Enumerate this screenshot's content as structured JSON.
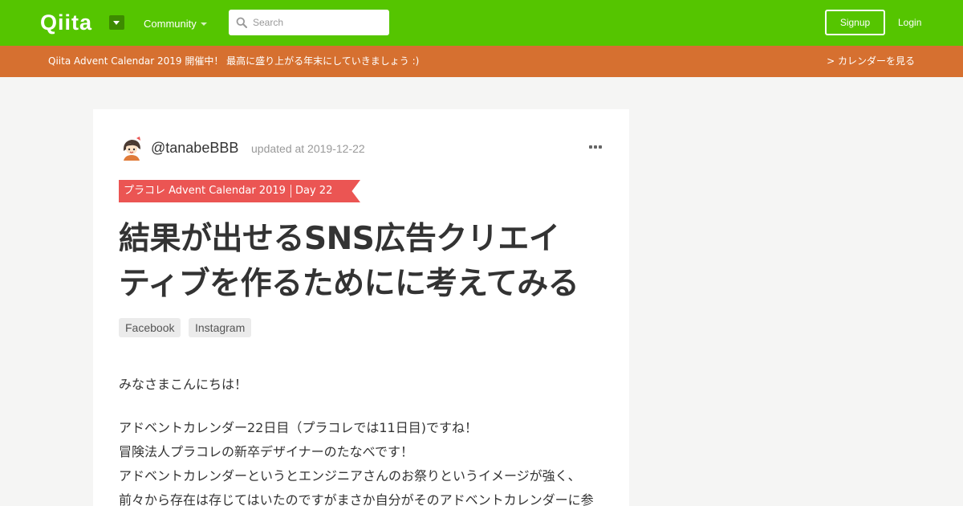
{
  "header": {
    "logo": "Qiita",
    "community_label": "Community",
    "search_placeholder": "Search",
    "signup_label": "Signup",
    "login_label": "Login",
    "bg_color": "#55c500"
  },
  "banner": {
    "text": "Qiita Advent Calendar 2019 開催中！ 最高に盛り上がる年末にしていきましょう :)",
    "link": "> カレンダーを見る",
    "bg_color": "#d67030"
  },
  "article": {
    "author": "@tanabeBBB",
    "updated": "updated at 2019-12-22",
    "calendar_name": "プラコレ Advent Calendar 2019",
    "calendar_day": "Day 22",
    "title_line1": "結果が出せるSNS広告クリエイ",
    "title_line2": "ティブを作るためにに考えてみる",
    "tags": [
      "Facebook",
      "Instagram"
    ],
    "body": [
      "みなさまこんにちは！",
      "アドベントカレンダー22日目（プラコレでは11日目)ですね！",
      "冒険法人プラコレの新卒デザイナーのたなべです！",
      "アドベントカレンダーというとエンジニアさんのお祭りというイメージが強く、",
      "前々から存在は存じてはいたのですがまさか自分がそのアドベントカレンダーに参"
    ]
  }
}
